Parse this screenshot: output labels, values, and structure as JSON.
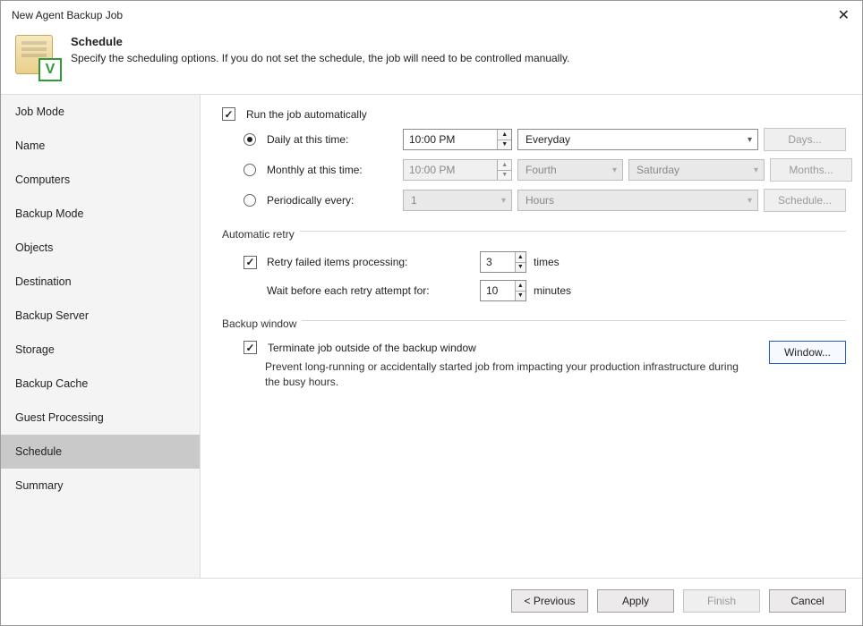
{
  "window": {
    "title": "New Agent Backup Job"
  },
  "header": {
    "title": "Schedule",
    "subtitle": "Specify the scheduling options. If you do not set the schedule, the job will need to be controlled manually."
  },
  "sidebar": {
    "items": [
      {
        "label": "Job Mode"
      },
      {
        "label": "Name"
      },
      {
        "label": "Computers"
      },
      {
        "label": "Backup Mode"
      },
      {
        "label": "Objects"
      },
      {
        "label": "Destination"
      },
      {
        "label": "Backup Server"
      },
      {
        "label": "Storage"
      },
      {
        "label": "Backup Cache"
      },
      {
        "label": "Guest Processing"
      },
      {
        "label": "Schedule"
      },
      {
        "label": "Summary"
      }
    ],
    "active_index": 10
  },
  "schedule": {
    "run_automatically_label": "Run the job automatically",
    "daily": {
      "label": "Daily at this time:",
      "time": "10:00 PM",
      "day": "Everyday",
      "button": "Days..."
    },
    "monthly": {
      "label": "Monthly at this time:",
      "time": "10:00 PM",
      "ordinal": "Fourth",
      "weekday": "Saturday",
      "button": "Months..."
    },
    "periodic": {
      "label": "Periodically every:",
      "value": "1",
      "unit": "Hours",
      "button": "Schedule..."
    }
  },
  "retry": {
    "section": "Automatic retry",
    "retry_label": "Retry failed items processing:",
    "retry_value": "3",
    "retry_unit": "times",
    "wait_label": "Wait before each retry attempt for:",
    "wait_value": "10",
    "wait_unit": "minutes"
  },
  "backup_window": {
    "section": "Backup window",
    "terminate_label": "Terminate job outside of the backup window",
    "description": "Prevent long-running or accidentally started job from impacting your production infrastructure during the busy hours.",
    "button": "Window..."
  },
  "footer": {
    "previous": "< Previous",
    "apply": "Apply",
    "finish": "Finish",
    "cancel": "Cancel"
  }
}
